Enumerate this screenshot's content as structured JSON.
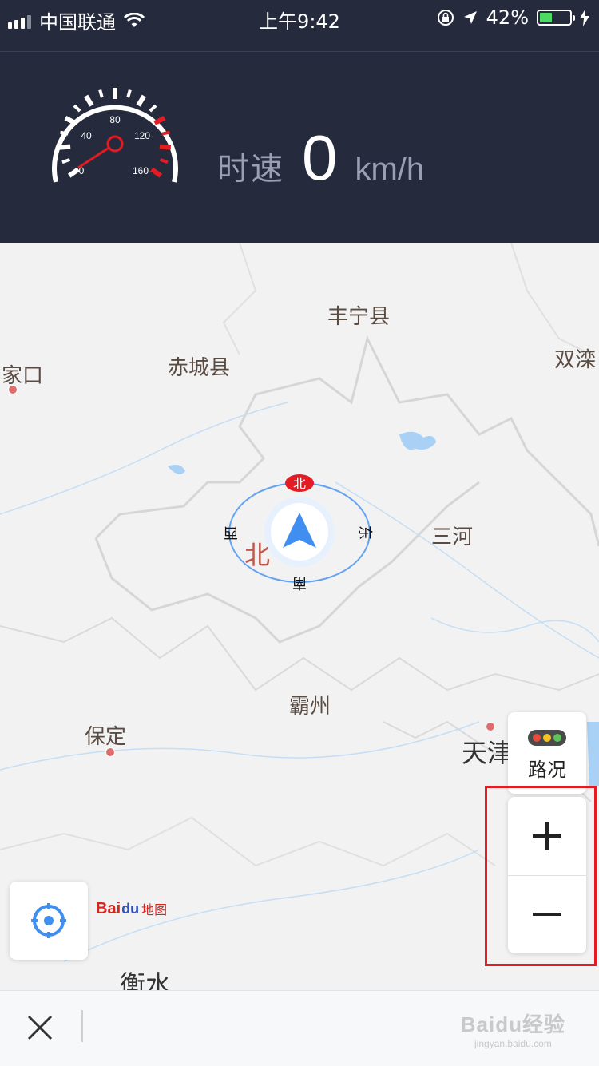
{
  "status_bar": {
    "carrier": "中国联通",
    "time": "上午9:42",
    "battery_percent": "42%",
    "battery_level": 0.42,
    "icons": [
      "signal-icon",
      "wifi-icon",
      "orientation-lock-icon",
      "location-arrow-icon",
      "battery-icon",
      "charging-bolt-icon"
    ]
  },
  "speed_panel": {
    "label": "时速",
    "value": "0",
    "unit": "km/h",
    "gauge_ticks": [
      "0",
      "40",
      "80",
      "120",
      "160"
    ]
  },
  "map": {
    "places": [
      {
        "id": "fengning",
        "name": "丰宁县"
      },
      {
        "id": "chicheng",
        "name": "赤城县"
      },
      {
        "id": "zhangjiakou",
        "name": "家口"
      },
      {
        "id": "shuangluan",
        "name": "双滦"
      },
      {
        "id": "sanhe",
        "name": "三河"
      },
      {
        "id": "bazhou",
        "name": "霸州"
      },
      {
        "id": "baoding",
        "name": "保定"
      },
      {
        "id": "tianjin",
        "name": "天津"
      },
      {
        "id": "hengshui",
        "name": "衡水"
      },
      {
        "id": "beijing",
        "name": "北"
      }
    ],
    "compass": {
      "north": "北",
      "east": "东",
      "south": "南",
      "west": "西"
    },
    "traffic_label": "路况",
    "zoom_in_label": "+",
    "zoom_out_label": "−",
    "logo": {
      "left": "Bai",
      "paw": "du",
      "right": "地图"
    }
  },
  "bottom_bar": {
    "watermark_main": "Baidu经验",
    "watermark_sub": "jingyan.baidu.com"
  },
  "colors": {
    "header_bg": "#252a3d",
    "accent_red": "#e31b23",
    "compass_blue": "#3f8ef0"
  }
}
